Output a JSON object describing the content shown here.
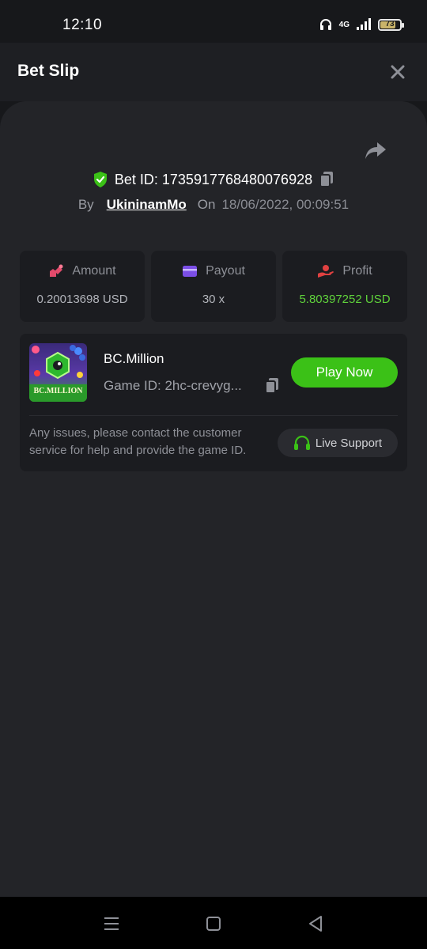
{
  "status_bar": {
    "time": "12:10",
    "network": "4G",
    "battery": "73",
    "battery_level": 0.73
  },
  "header": {
    "title": "Bet Slip"
  },
  "bet": {
    "id_label": "Bet ID: 1735917768480076928",
    "by_label": "By",
    "user": "UkininamMo",
    "on_label": "On",
    "date": "18/06/2022, 00:09:51"
  },
  "stats": {
    "amount": {
      "label": "Amount",
      "value": "0.20013698 USD"
    },
    "payout": {
      "label": "Payout",
      "value": "30 x"
    },
    "profit": {
      "label": "Profit",
      "value": "5.80397252 USD"
    }
  },
  "game": {
    "name": "BC.Million",
    "game_id": "Game ID: 2hc-crevyg...",
    "thumb_text": "BC.MILLION",
    "play_label": "Play Now",
    "issue_text": "Any issues, please contact the customer service for help and provide the game ID.",
    "support_label": "Live Support"
  },
  "colors": {
    "accent_green": "#3bc117",
    "profit_green": "#5fd13b",
    "amount_icon": "#e24a6b",
    "payout_icon": "#7b4ee6",
    "profit_icon": "#e04141"
  }
}
